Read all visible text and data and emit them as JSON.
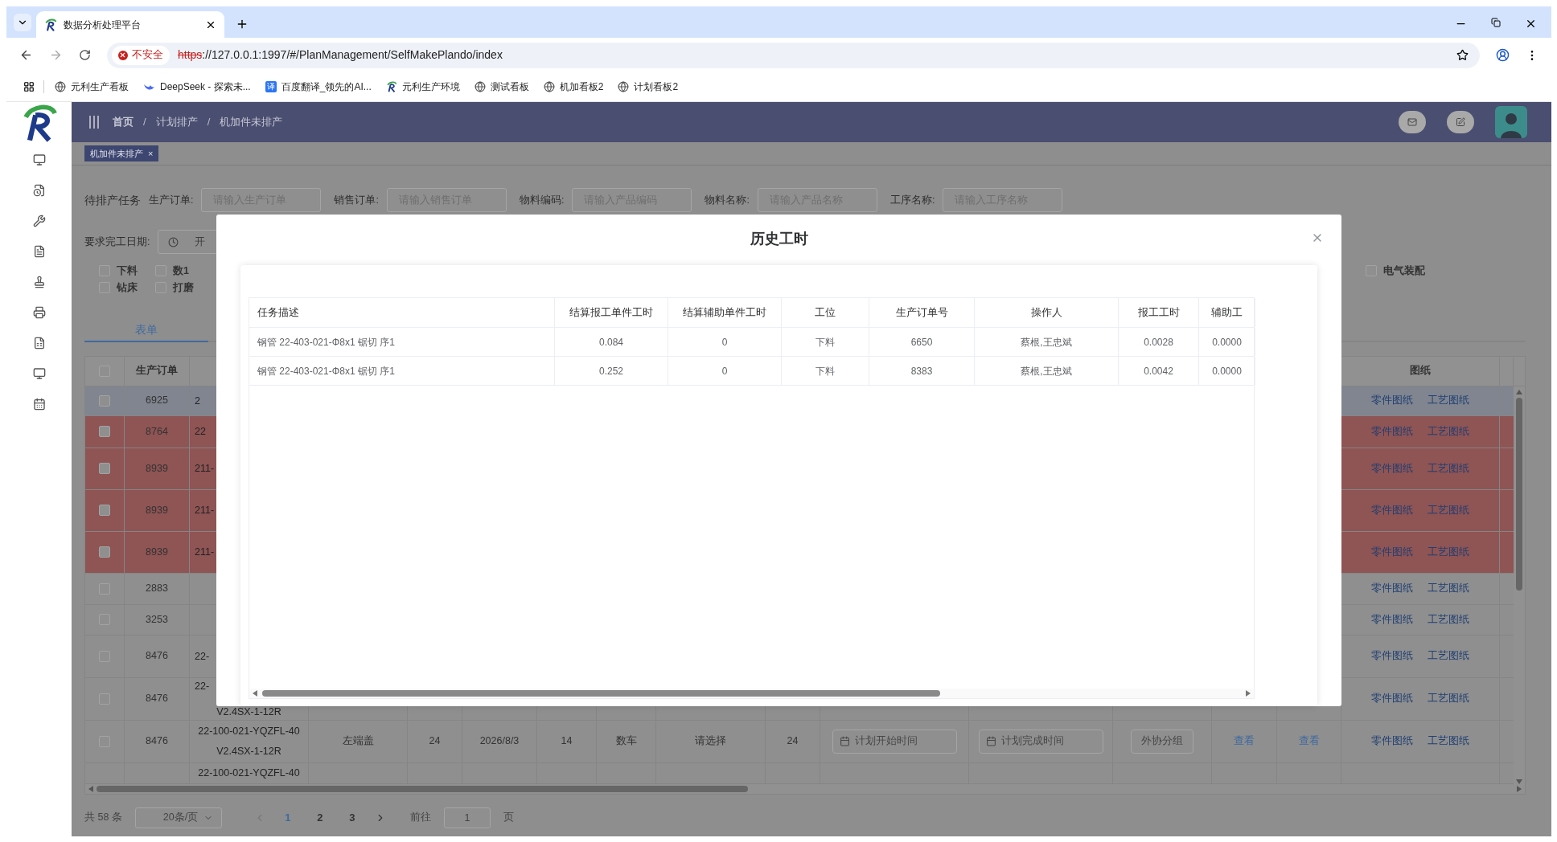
{
  "browser": {
    "tab": {
      "title": "数据分析处理平台",
      "selected": true
    },
    "security": "不安全",
    "url_scheme": "https",
    "url_rest": "://127.0.0.1:1997/#/PlanManagement/SelfMakePlando/index",
    "bookmarks": [
      {
        "kind": "globe",
        "label": "元利生产看板"
      },
      {
        "kind": "whale",
        "label": "DeepSeek - 探索未..."
      },
      {
        "kind": "translate",
        "icon_text": "译",
        "label": "百度翻译_领先的AI..."
      },
      {
        "kind": "logo",
        "label": "元利生产环境"
      },
      {
        "kind": "globe",
        "label": "测试看板"
      },
      {
        "kind": "globe",
        "label": "机加看板2"
      },
      {
        "kind": "globe",
        "label": "计划看板2"
      }
    ]
  },
  "header": {
    "breadcrumb": [
      {
        "kind": "link",
        "label": "首页"
      },
      {
        "kind": "separator",
        "label": "/"
      },
      {
        "kind": "link",
        "label": "计划排产"
      },
      {
        "kind": "separator",
        "label": "/"
      },
      {
        "kind": "link",
        "label": "机加件未排产"
      }
    ]
  },
  "tags": [
    {
      "label": "机加件未排产",
      "close": "×",
      "selected": true
    }
  ],
  "filters": {
    "title": "待排产任务",
    "fields": [
      {
        "label": "生产订单:",
        "placeholder": "请输入生产订单"
      },
      {
        "label": "销售订单:",
        "placeholder": "请输入销售订单"
      },
      {
        "label": "物料编码:",
        "placeholder": "请输入产品编码"
      },
      {
        "label": "物料名称:",
        "placeholder": "请输入产品名称"
      },
      {
        "label": "工序名称:",
        "placeholder": "请输入工序名称"
      }
    ],
    "date": {
      "label": "要求完工日期:",
      "placeholder": "开"
    }
  },
  "processes": [
    {
      "label": "下料",
      "checked": false
    },
    {
      "label": "钻床",
      "checked": false
    },
    {
      "label": "数1",
      "checked": false
    },
    {
      "label": "打磨",
      "checked": false
    }
  ],
  "processes_right": [
    {
      "label": "电气装配",
      "checked": false
    }
  ],
  "form_tabs": [
    {
      "label": "表单",
      "selected": true
    }
  ],
  "table": {
    "select_all": {
      "checked": false
    },
    "order_header": "生产订单",
    "drawings_header": "图纸",
    "rows": [
      {
        "kind": "covered",
        "order": "6925",
        "product": [
          "2"
        ],
        "color": "#80858f",
        "drawings": [
          "零件图纸",
          "工艺图纸"
        ]
      },
      {
        "kind": "covered",
        "order": "8764",
        "product": [
          "22"
        ],
        "color": "#8f5454",
        "drawings": [
          "零件图纸",
          "工艺图纸"
        ]
      },
      {
        "kind": "covered",
        "order": "8939",
        "product": [
          "211-"
        ],
        "color": "#8f5454",
        "drawings": [
          "零件图纸",
          "工艺图纸"
        ]
      },
      {
        "kind": "covered",
        "order": "8939",
        "product": [
          "211-"
        ],
        "color": "#8f5454",
        "drawings": [
          "零件图纸",
          "工艺图纸"
        ]
      },
      {
        "kind": "covered",
        "order": "8939",
        "product": [
          "211-"
        ],
        "color": "#8f5454",
        "drawings": [
          "零件图纸",
          "工艺图纸"
        ]
      },
      {
        "kind": "covered",
        "order": "2883",
        "product": [],
        "color": "#8f8f8f",
        "drawings": [
          "零件图纸",
          "工艺图纸"
        ]
      },
      {
        "kind": "covered",
        "order": "3253",
        "product": [],
        "color": "#8f8f8f",
        "drawings": [
          "零件图纸",
          "工艺图纸"
        ]
      },
      {
        "kind": "covered",
        "order": "8476",
        "product": [
          "22-"
        ],
        "color": "#8f8f8f",
        "drawings": [
          "零件图纸",
          "工艺图纸"
        ]
      },
      {
        "kind": "covered",
        "order": "8476",
        "product": [
          "22-",
          "V2.4SX-1-12R"
        ],
        "color": "#8f8f8f",
        "drawings": [
          "零件图纸",
          "工艺图纸"
        ]
      },
      {
        "kind": "full",
        "order": "8476",
        "product": [
          "22-100-021-YQZFL-40",
          "V2.4SX-1-12R"
        ],
        "color": "#8f8f8f",
        "part": "左端盖",
        "qty": "24",
        "due": "2026/8/3",
        "count": "14",
        "process": "数车",
        "select": "请选择",
        "qty2": "24",
        "start": "计划开始时间",
        "end": "计划完成时间",
        "outsource": "外协分组",
        "view1": "查看",
        "view2": "查看",
        "drawings": [
          "零件图纸",
          "工艺图纸"
        ]
      },
      {
        "kind": "clipped",
        "product": [
          "22-100-021-YQZFL-40"
        ],
        "color": "#8f8f8f"
      }
    ]
  },
  "pagination": {
    "total": "共 58 条",
    "page_size": "20条/页",
    "pages": [
      {
        "label": "1",
        "selected": true
      },
      {
        "label": "2",
        "selected": false
      },
      {
        "label": "3",
        "selected": false
      }
    ],
    "goto_label": "前往",
    "goto_value": "1",
    "goto_suffix": "页"
  },
  "dialog": {
    "title": "历史工时",
    "columns": [
      "任务描述",
      "结算报工单件工时",
      "结算辅助单件工时",
      "工位",
      "生产订单号",
      "操作人",
      "报工工时",
      "辅助工"
    ],
    "rows": [
      [
        "钢管 22-403-021-Φ8x1 锯切 序1",
        "0.084",
        "0",
        "下料",
        "6650",
        "蔡根,王忠斌",
        "0.0028",
        "0.0000"
      ],
      [
        "钢管 22-403-021-Φ8x1 锯切 序1",
        "0.252",
        "0",
        "下料",
        "8383",
        "蔡根,王忠斌",
        "0.0042",
        "0.0000"
      ]
    ]
  }
}
